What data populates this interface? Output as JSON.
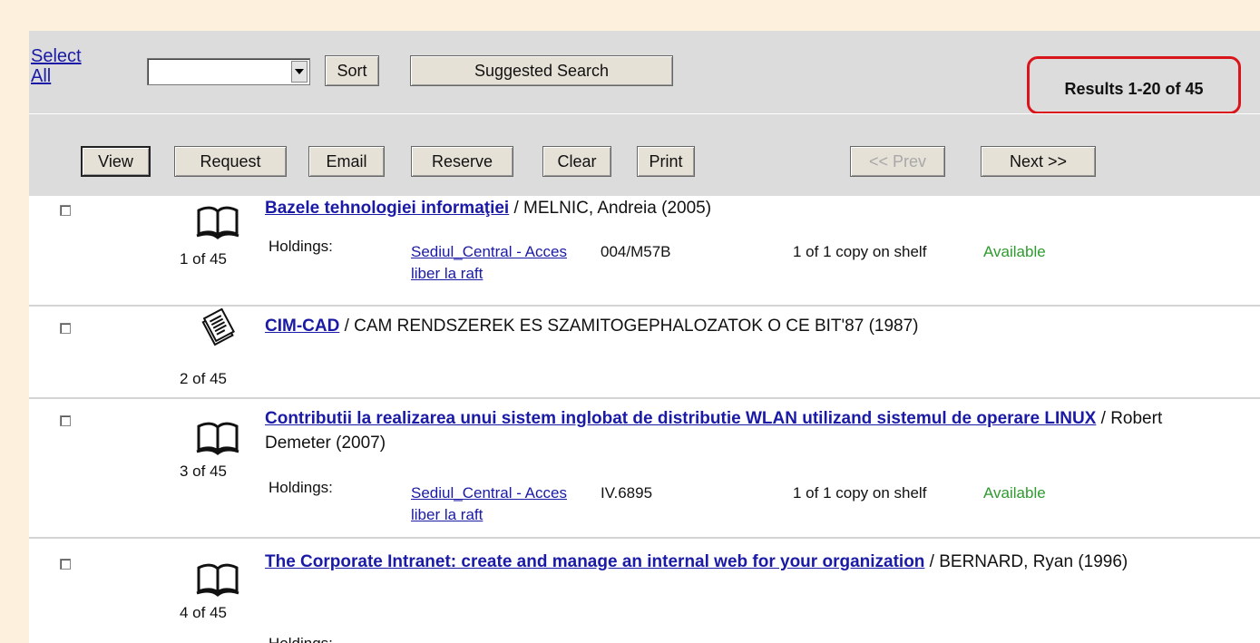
{
  "toolbar": {
    "select_all": "Select All",
    "sort_label": "Sort",
    "suggested_search_label": "Suggested Search",
    "results_count": "Results 1-20 of 45"
  },
  "actions": {
    "view": "View",
    "request": "Request",
    "email": "Email",
    "reserve": "Reserve",
    "clear": "Clear",
    "print": "Print",
    "prev": "<< Prev",
    "next": "Next >>"
  },
  "results": [
    {
      "count": "1 of 45",
      "icon": "book-icon",
      "title": "Bazele tehnologiei informaţiei",
      "rest": " / MELNIC, Andreia  (2005)",
      "holdings_label": "Holdings:",
      "location": "Sediul_Central - Acces liber la raft",
      "call_number": "004/M57B",
      "copies": "1 of 1 copy on shelf",
      "status": "Available"
    },
    {
      "count": "2 of 45",
      "icon": "document-icon",
      "title": "CIM-CAD",
      "rest": " / CAM RENDSZEREK ES SZAMITOGEPHALOZATOK O CE BIT'87 (1987)"
    },
    {
      "count": "3 of 45",
      "icon": "book-icon",
      "title": "Contributii la realizarea unui sistem inglobat de distributie WLAN utilizand sistemul de operare LINUX",
      "rest": " / Robert Demeter (2007)",
      "holdings_label": "Holdings:",
      "location": "Sediul_Central - Acces liber la raft",
      "call_number": "IV.6895",
      "copies": "1 of 1 copy on shelf",
      "status": "Available"
    },
    {
      "count": "4 of 45",
      "icon": "book-icon",
      "title": "The Corporate Intranet: create and manage an internal web for your organization",
      "rest": " / BERNARD, Ryan  (1996)",
      "holdings_label": "Holdings:"
    }
  ],
  "colors": {
    "link": "#1a1aa6",
    "available": "#2e9a2e",
    "highlight": "#d9141b",
    "toolbar_bg": "#dcdcdc",
    "frame_bg": "#fdf0dc"
  }
}
